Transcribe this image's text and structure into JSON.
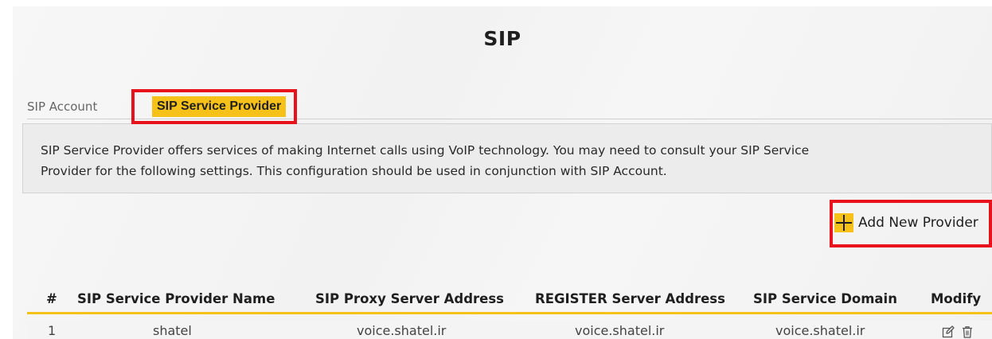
{
  "page": {
    "title": "SIP"
  },
  "tabs": [
    {
      "label": "SIP Account",
      "active": false
    },
    {
      "label": "SIP Service Provider",
      "active": true
    }
  ],
  "info": {
    "line1": "SIP Service Provider offers services of making Internet calls using VoIP technology. You may need to consult your SIP Service",
    "line2": "Provider for the following settings. This configuration should be used in conjunction with SIP Account."
  },
  "actions": {
    "add_new_provider": "Add New Provider"
  },
  "table": {
    "headers": [
      "#",
      "SIP Service Provider Name",
      "SIP Proxy Server Address",
      "REGISTER Server Address",
      "SIP Service Domain",
      "Modify"
    ],
    "rows": [
      {
        "index": "1",
        "name": "shatel",
        "proxy": "voice.shatel.ir",
        "register": "voice.shatel.ir",
        "domain": "voice.shatel.ir"
      }
    ]
  },
  "icons": {
    "add": "plus-icon",
    "edit": "edit-icon",
    "delete": "trash-icon"
  },
  "colors": {
    "accent": "#f6c21a",
    "highlight": "#e8121c"
  }
}
